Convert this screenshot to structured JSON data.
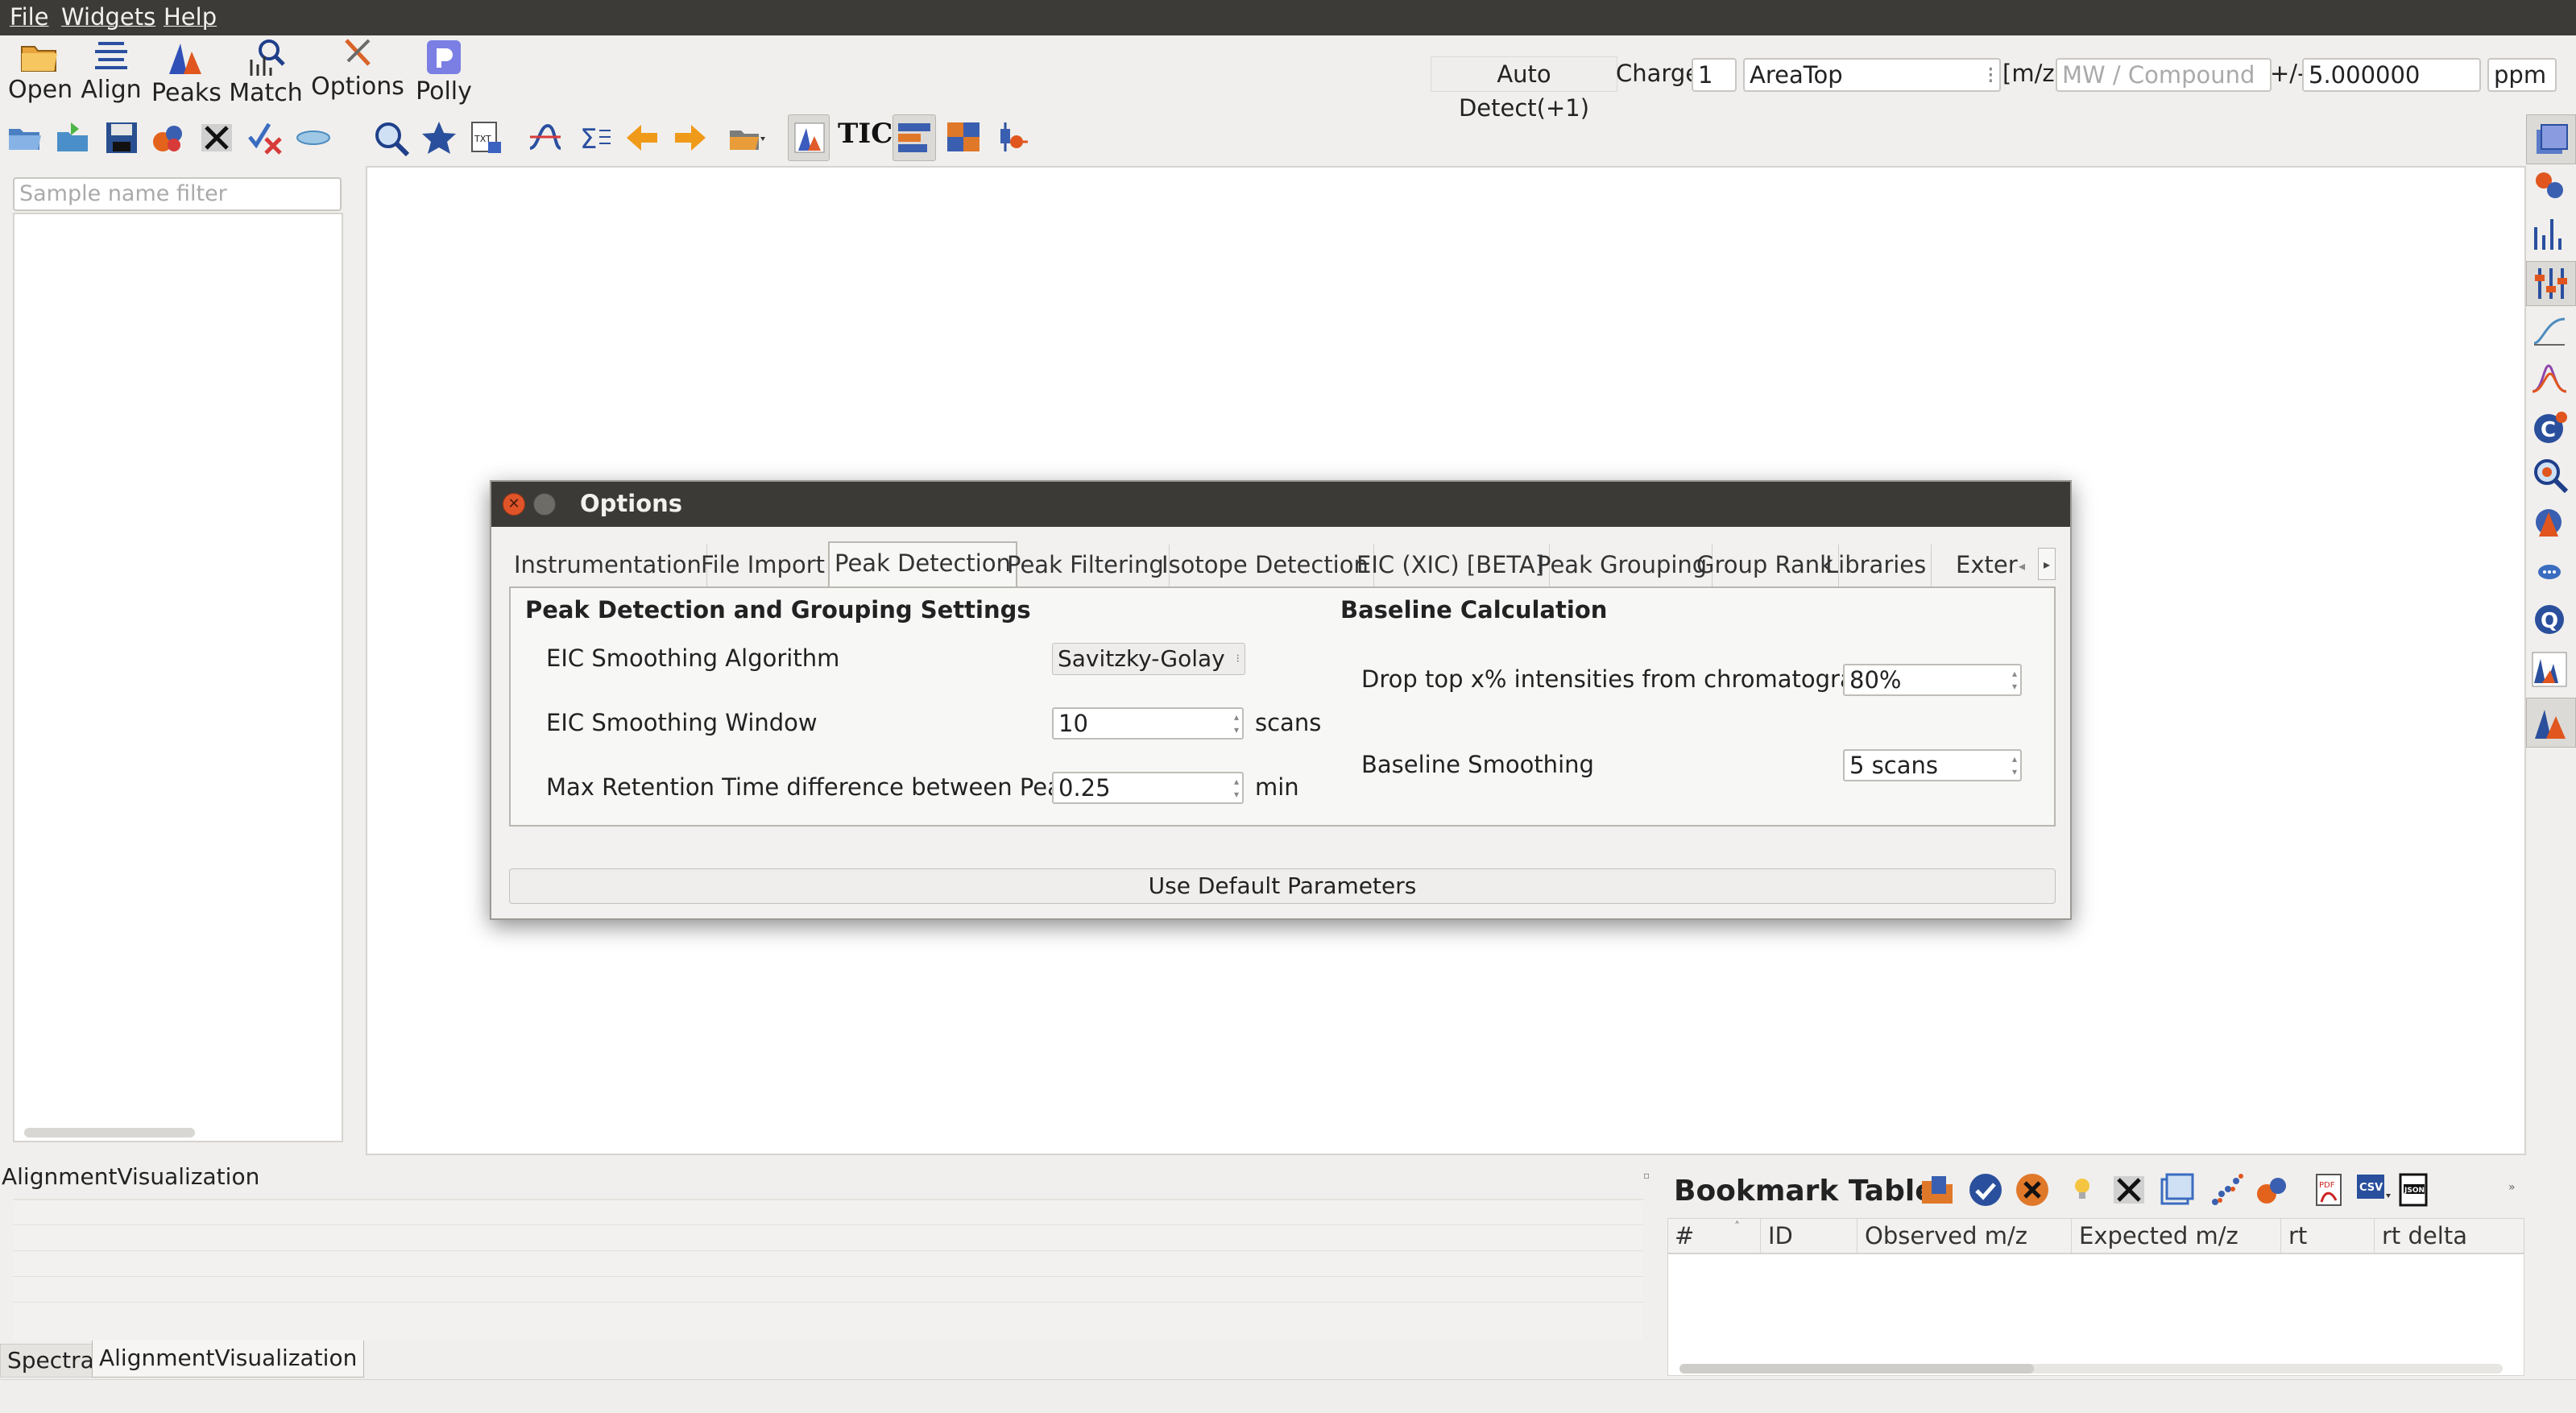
{
  "menu": [
    "File",
    "Widgets",
    "Help"
  ],
  "main_toolbar": [
    {
      "label": "Open",
      "icon": "open-folder-icon"
    },
    {
      "label": "Align",
      "icon": "align-icon"
    },
    {
      "label": "Peaks",
      "icon": "peaks-icon"
    },
    {
      "label": "Match",
      "icon": "match-icon"
    },
    {
      "label": "Options",
      "icon": "options-icon"
    },
    {
      "label": "Polly",
      "icon": "polly-icon"
    }
  ],
  "search_bar": {
    "auto_detect": "Auto Detect(+1)",
    "charge_label": "Charge",
    "charge_value": "1",
    "quant_type": "AreaTop",
    "mz_label": "[m/z]",
    "compound_placeholder": "MW / Compound",
    "tolerance_label": "+/-",
    "tolerance_value": "5.000000",
    "tolerance_unit": "ppm"
  },
  "secondary_toolbar": {
    "tic_label": "TIC"
  },
  "sample_panel": {
    "filter_placeholder": "Sample name filter"
  },
  "options_dialog": {
    "title": "Options",
    "tabs": [
      "Instrumentation",
      "File Import",
      "Peak Detection",
      "Peak Filtering",
      "Isotope Detection",
      "EIC (XIC) [BETA]",
      "Peak Grouping",
      "Group Rank",
      "Libraries",
      "Exter"
    ],
    "active_tab": "Peak Detection",
    "left_section": {
      "heading": "Peak Detection and Grouping Settings",
      "smoothing_algorithm_label": "EIC Smoothing Algorithm",
      "smoothing_algorithm_value": "Savitzky-Golay",
      "smoothing_window_label": "EIC Smoothing Window",
      "smoothing_window_value": "10",
      "smoothing_window_unit": "scans",
      "max_rt_label": "Max Retention Time difference between Peaks",
      "max_rt_value": "0.25",
      "max_rt_unit": "min"
    },
    "right_section": {
      "heading": "Baseline Calculation",
      "drop_top_label": "Drop top x%  intensities from chromatogram",
      "drop_top_value": "80%",
      "baseline_smoothing_label": "Baseline Smoothing",
      "baseline_smoothing_value": "5 scans"
    },
    "default_button": "Use Default Parameters"
  },
  "alignment_panel": {
    "title": "AlignmentVisualization"
  },
  "bottom_tabs": [
    "Spectra",
    "AlignmentVisualization"
  ],
  "bookmark_table": {
    "title": "Bookmark Table",
    "columns": [
      "#",
      "ID",
      "Observed m/z",
      "Expected m/z",
      "rt",
      "rt delta"
    ]
  }
}
